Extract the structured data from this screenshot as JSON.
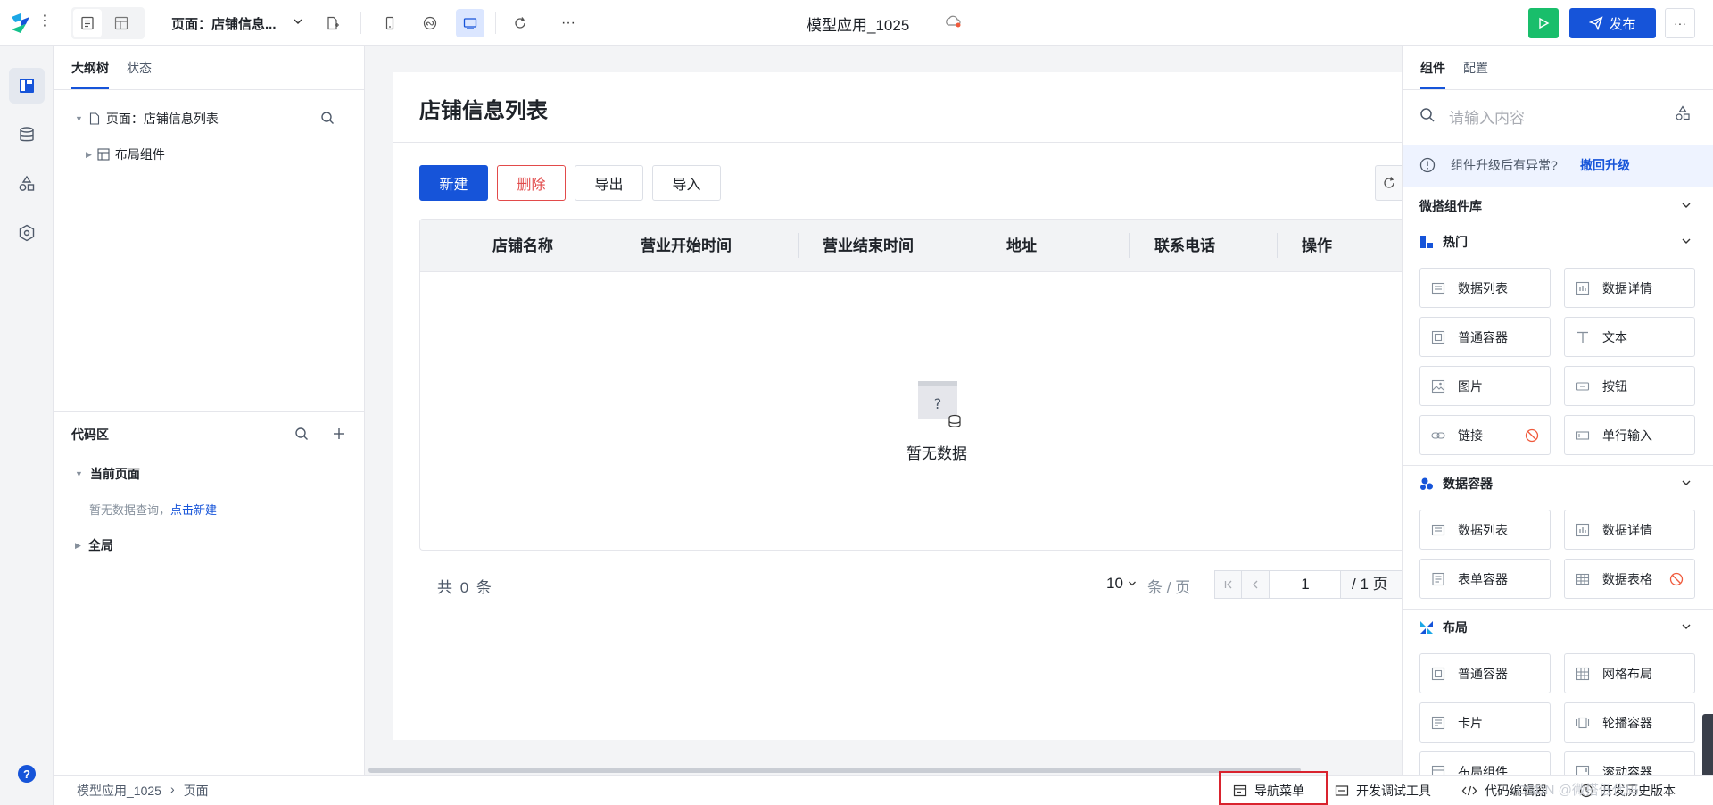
{
  "topbar": {
    "page_select": "页面：店铺信息...",
    "app_title": "模型应用_1025",
    "publish_label": "发布"
  },
  "outline": {
    "tabs": [
      "大纲树",
      "状态"
    ],
    "tree": [
      {
        "label": "页面：店铺信息列表"
      },
      {
        "label": "布局组件"
      }
    ],
    "code_title": "代码区",
    "current_page": "当前页面",
    "empty_hint": "暂无数据查询，",
    "empty_link": "点击新建",
    "global": "全局"
  },
  "page": {
    "title": "店铺信息列表",
    "buttons": {
      "create": "新建",
      "delete": "删除",
      "export": "导出",
      "import": "导入"
    },
    "columns": [
      "店铺名称",
      "营业开始时间",
      "营业结束时间",
      "地址",
      "联系电话",
      "操作"
    ],
    "empty_text": "暂无数据",
    "empty_question": "?",
    "total": "共 0 条",
    "page_size": "10",
    "page_unit": "条 / 页",
    "current_page": "1",
    "total_pages": "/ 1 页"
  },
  "rpanel": {
    "tabs": [
      "组件",
      "配置"
    ],
    "search_placeholder": "请输入内容",
    "notice_text": "组件升级后有异常?",
    "notice_link": "撤回升级",
    "library": "微搭组件库",
    "sections": [
      {
        "title": "热门",
        "items": [
          "数据列表",
          "数据详情",
          "普通容器",
          "文本",
          "图片",
          "按钮",
          "链接",
          "单行输入"
        ]
      },
      {
        "title": "数据容器",
        "items": [
          "数据列表",
          "数据详情",
          "表单容器",
          "数据表格"
        ]
      },
      {
        "title": "布局",
        "items": [
          "普通容器",
          "网格布局",
          "卡片",
          "轮播容器",
          "布局组件",
          "滚动容器"
        ]
      }
    ]
  },
  "bottombar": {
    "breadcrumb": [
      "模型应用_1025",
      "页面"
    ],
    "items": [
      "导航菜单",
      "开发调试工具",
      "代码编辑器",
      "开发历史版本"
    ],
    "watermark": "CSDN @微搭低代码"
  },
  "colors": {
    "primary": "#1654d9",
    "danger": "#e24a4a",
    "run": "#19be6b",
    "highlight": "#d9232e"
  }
}
